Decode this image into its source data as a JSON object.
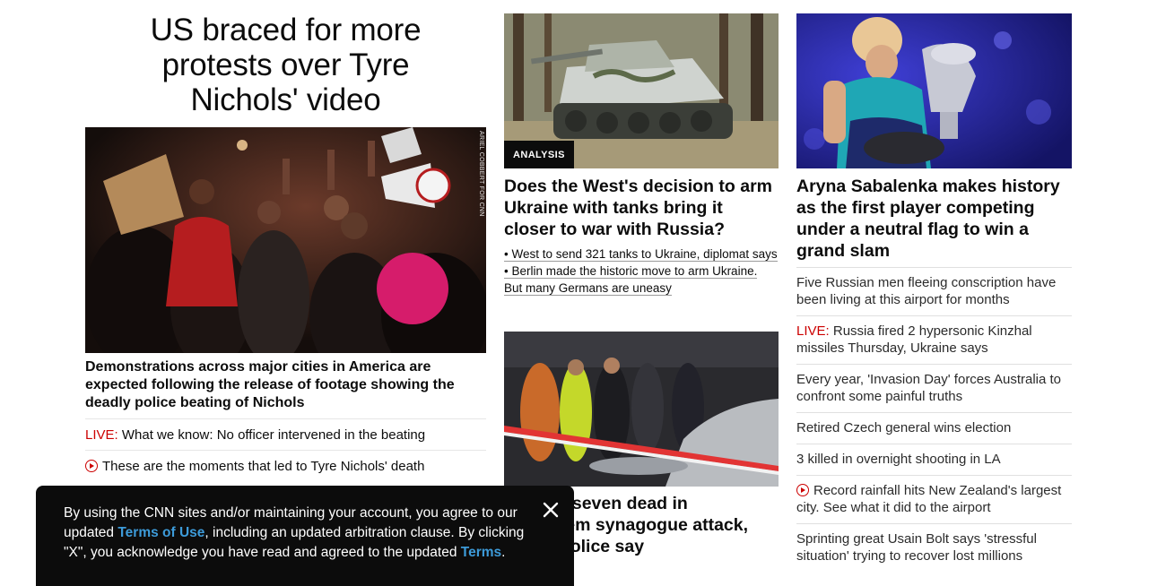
{
  "hero": {
    "title": "US braced for more protests over Tyre Nichols' video",
    "photo_credit": "ARIEL COBBERT FOR CNN",
    "summary": "Demonstrations across major cities in America are expected following the release of footage showing the deadly police beating of Nichols",
    "links": [
      {
        "prefix": "LIVE:",
        "text": " What we know: No officer intervened in the beating",
        "icon": ""
      },
      {
        "prefix": "",
        "text": "These are the moments that led to Tyre Nichols' death",
        "icon": "play-icon"
      }
    ]
  },
  "tank_story": {
    "badge": "ANALYSIS",
    "title": "Does the West's decision to arm Ukraine with tanks bring it closer to war with Russia?",
    "bullets": [
      "• West to send 321 tanks to Ukraine, diplomat says",
      "• Berlin made the historic move to arm Ukraine. But many Germans are uneasy"
    ]
  },
  "synagogue_story": {
    "title": "At least seven dead in Jerusalem synagogue attack, Israeli police say"
  },
  "sabalenka_story": {
    "title": "Aryna Sabalenka makes history as the first player competing under a neutral flag to win a grand slam",
    "links": [
      {
        "prefix": "",
        "icon": "",
        "text": "Five Russian men fleeing conscription have been living at this airport for months"
      },
      {
        "prefix": "LIVE:",
        "icon": "",
        "text": " Russia fired 2 hypersonic Kinzhal missiles Thursday, Ukraine says"
      },
      {
        "prefix": "",
        "icon": "",
        "text": "Every year, 'Invasion Day' forces Australia to confront some painful truths"
      },
      {
        "prefix": "",
        "icon": "",
        "text": "Retired Czech general wins election"
      },
      {
        "prefix": "",
        "icon": "",
        "text": "3 killed in overnight shooting in LA"
      },
      {
        "prefix": "",
        "icon": "play-icon",
        "text": "Record rainfall hits New Zealand's largest city. See what it did to the airport"
      },
      {
        "prefix": "",
        "icon": "",
        "text": "Sprinting great Usain Bolt says 'stressful situation' trying to recover lost millions"
      }
    ]
  },
  "cookie_banner": {
    "text_1": "By using the CNN sites and/or maintaining your account, you agree to our updated ",
    "terms_of_use": "Terms of Use",
    "text_2": ", including an updated arbitration clause. By clicking \"X\", you acknowledge you have read and agreed to the updated ",
    "terms": "Terms",
    "text_3": ".",
    "close_icon": "close-icon"
  },
  "colors": {
    "live_red": "#cc0000",
    "link_blue": "#3d9bd9",
    "banner_bg": "#0c0c0c"
  }
}
